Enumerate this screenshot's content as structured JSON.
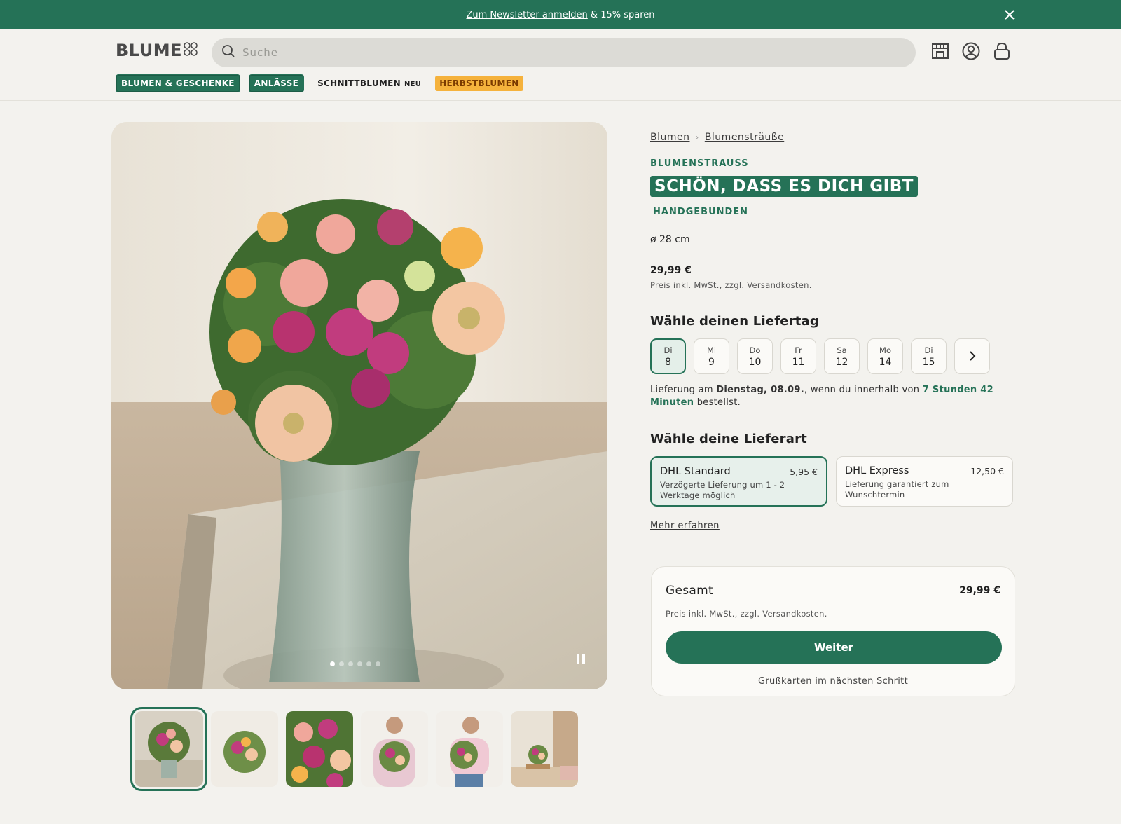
{
  "colors": {
    "brand": "#257257",
    "accent_orange": "#f5b23c",
    "background": "#f3f2ee"
  },
  "banner": {
    "link_text": "Zum Newsletter anmelden",
    "rest_text": " & 15% sparen"
  },
  "logo": {
    "text": "BLUME"
  },
  "search": {
    "placeholder": "Suche"
  },
  "nav": {
    "items": [
      {
        "label": "BLUMEN & GESCHENKE"
      },
      {
        "label": "ANLÄSSE"
      },
      {
        "label": "SCHNITTBLUMEN",
        "badge": "NEU"
      },
      {
        "label": "HERBSTBLUMEN"
      }
    ]
  },
  "gallery": {
    "slides": 6,
    "active_slide": 1,
    "thumbnails": 6
  },
  "product": {
    "breadcrumb": [
      "Blumen",
      "Blumensträuße"
    ],
    "category": "BLUMENSTRAUSS",
    "title": "SCHÖN, DASS ES DICH GIBT",
    "subtitle": "HANDGEBUNDEN",
    "size": "ø 28 cm",
    "price": "29,99 €",
    "tax_note": "Preis inkl. MwSt., zzgl. Versandkosten."
  },
  "delivery_day": {
    "heading": "Wähle deinen Liefertag",
    "days": [
      {
        "weekday": "Di",
        "day": "8",
        "selected": true
      },
      {
        "weekday": "Mi",
        "day": "9"
      },
      {
        "weekday": "Do",
        "day": "10"
      },
      {
        "weekday": "Fr",
        "day": "11"
      },
      {
        "weekday": "Sa",
        "day": "12"
      },
      {
        "weekday": "Mo",
        "day": "14"
      },
      {
        "weekday": "Di",
        "day": "15"
      }
    ],
    "info_prefix": "Lieferung am ",
    "info_date": "Dienstag, 08.09.",
    "info_mid": ", wenn du innerhalb von ",
    "info_time": "7 Stunden 42 Minuten",
    "info_suffix": " bestellst."
  },
  "delivery_type": {
    "heading": "Wähle deine Lieferart",
    "options": [
      {
        "name": "DHL Standard",
        "price": "5,95 €",
        "description": "Verzögerte Lieferung um 1 - 2 Werktage möglich",
        "selected": true
      },
      {
        "name": "DHL Express",
        "price": "12,50 €",
        "description": "Lieferung garantiert zum Wunschtermin"
      }
    ],
    "more_link": "Mehr erfahren"
  },
  "summary": {
    "label": "Gesamt",
    "amount": "29,99 €",
    "tax_note": "Preis inkl. MwSt., zzgl. Versandkosten.",
    "button": "Weiter",
    "note": "Grußkarten im nächsten Schritt"
  }
}
